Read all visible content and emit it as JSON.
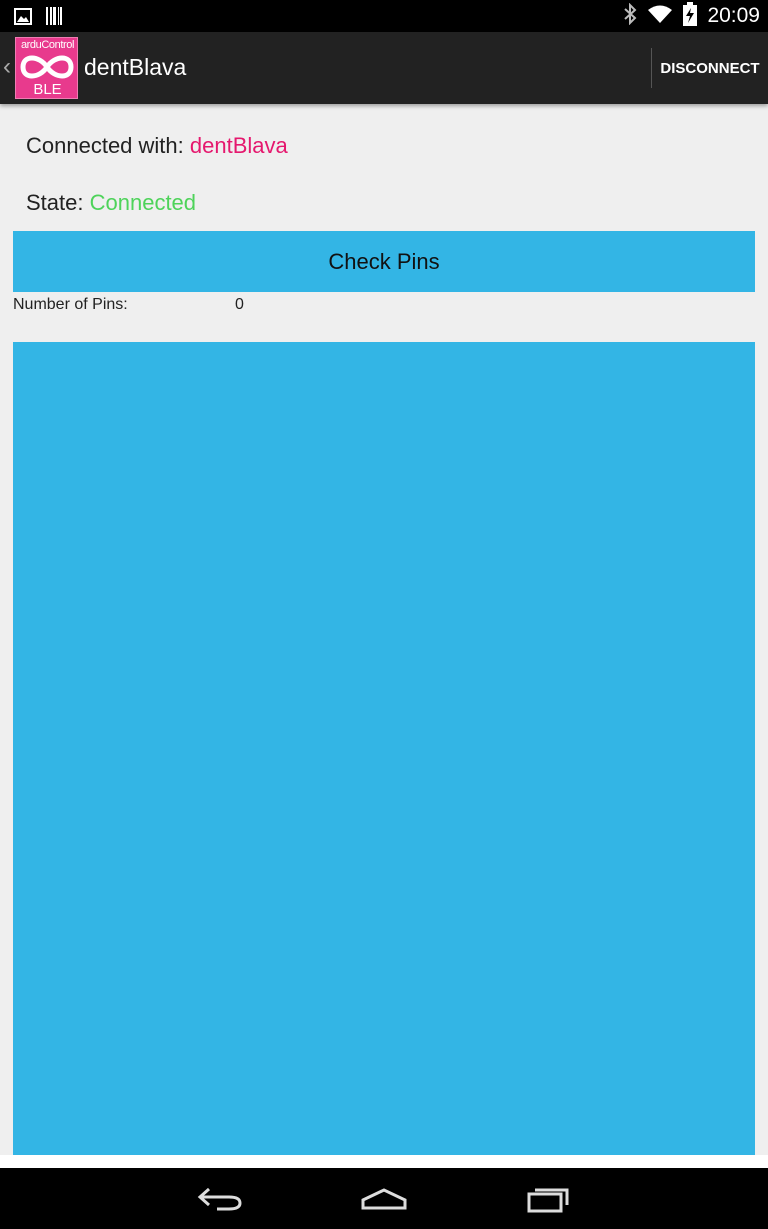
{
  "status_bar": {
    "time": "20:09",
    "icons_left": [
      "image-icon",
      "barcode-icon"
    ],
    "icons_right": [
      "bluetooth-icon",
      "wifi-icon",
      "battery-charging-icon"
    ]
  },
  "action_bar": {
    "logo_top": "arduControl",
    "logo_bottom": "BLE",
    "title": "dentBlava",
    "disconnect_label": "DISCONNECT"
  },
  "connection": {
    "label": "Connected with:",
    "device": "dentBlava",
    "state_label": "State:",
    "state_value": "Connected"
  },
  "pins": {
    "check_button": "Check Pins",
    "count_label": "Number of Pins:",
    "count_value": "0"
  },
  "colors": {
    "accent": "#33b5e5",
    "device_name": "#e5186e",
    "state_ok": "#4ed35a",
    "logo_bg": "#e83a8d"
  },
  "nav_bar": {
    "buttons": [
      "back-icon",
      "home-icon",
      "recent-apps-icon"
    ]
  }
}
